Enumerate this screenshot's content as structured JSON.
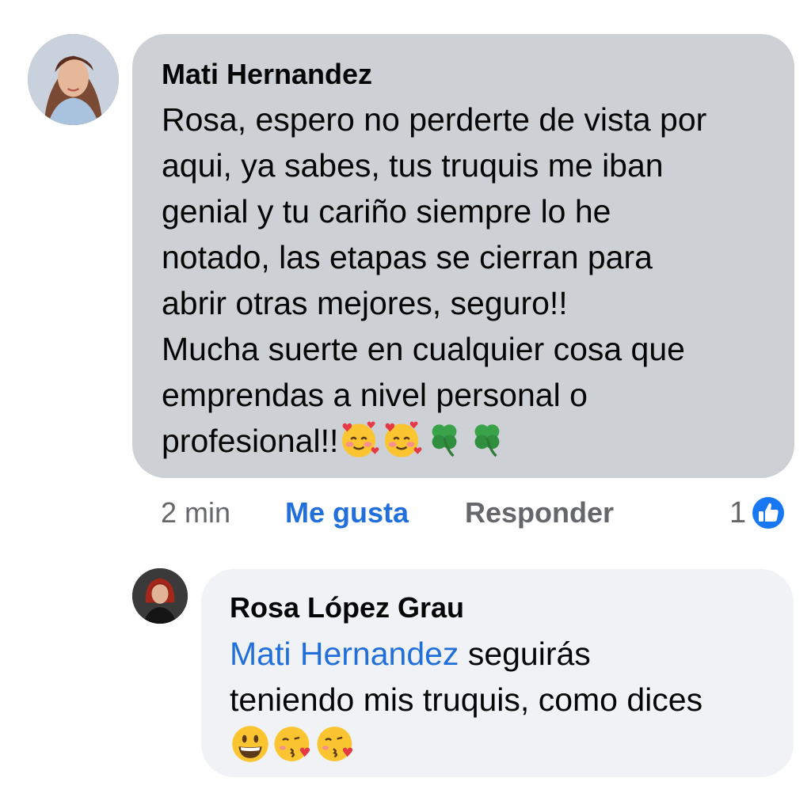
{
  "comment": {
    "author": "Mati Hernandez",
    "lines": [
      "Rosa, espero no perderte de vista por",
      "aqui, ya sabes, tus truquis me iban",
      "genial y tu cariño siempre lo he",
      "notado, las etapas se cierran para",
      "abrir otras mejores, seguro!!",
      "Mucha suerte en cualquier cosa que",
      "emprendas a nivel personal o",
      "profesional!!"
    ],
    "trailing_emojis": [
      "smiling-face-with-hearts",
      "smiling-face-with-hearts",
      "four-leaf-clover",
      "four-leaf-clover"
    ],
    "time": "2 min",
    "like_label": "Me gusta",
    "reply_label": "Responder",
    "reaction_count": "1",
    "reaction_icon": "thumbs-up-icon",
    "colors": {
      "bubble": "#cdd0d5",
      "link": "#216fdb",
      "secondary_text": "#65676b"
    }
  },
  "reply": {
    "author": "Rosa López Grau",
    "mention": "Mati Hernandez",
    "line1_rest": " seguirás",
    "line2": "teniendo mis truquis, como dices",
    "trailing_emojis": [
      "grinning-face",
      "face-blowing-kiss",
      "face-blowing-kiss"
    ],
    "colors": {
      "bubble": "#f0f2f5"
    }
  }
}
